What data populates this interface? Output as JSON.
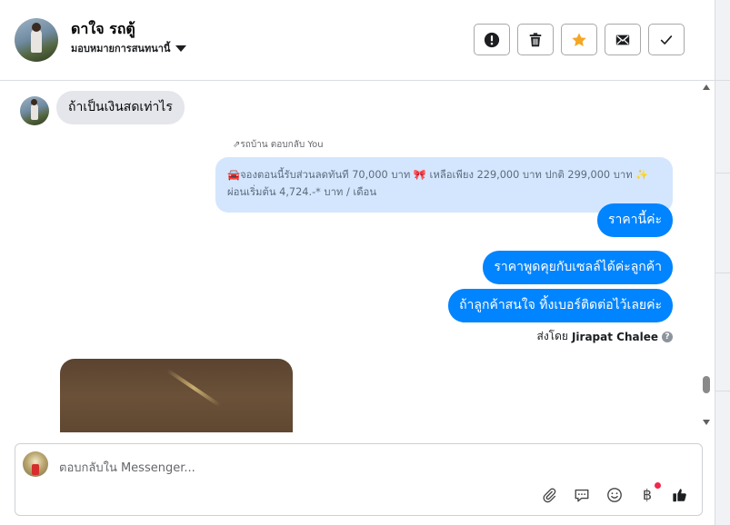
{
  "header": {
    "contact_name": "ดาใจ รถตู้",
    "assign_label": "มอบหมายการสนทนานี้",
    "buttons": [
      {
        "name": "spam-alert",
        "icon": "alert-circle-icon"
      },
      {
        "name": "delete",
        "icon": "trash-icon"
      },
      {
        "name": "star",
        "icon": "star-icon",
        "color": "#f5a623"
      },
      {
        "name": "mark-unread",
        "icon": "envelope-icon"
      },
      {
        "name": "mark-done",
        "icon": "checkmark-icon"
      }
    ]
  },
  "thread": {
    "incoming_message": "ถ้าเป็นเงินสดเท่าไร",
    "reply_meta": "รถบ้าน ตอบกลับ You",
    "quoted_message": "🚘จองตอนนี้รับส่วนลดทันที 70,000 บาท 🎀 เหลือเพียง 229,000 บาท ปกติ 299,000 บาท ✨ ผ่อนเริ่มต้น 4,724.-* บาท / เดือน",
    "outgoing_messages": [
      "ราคานี้ค่ะ",
      "ราคาพูดคุยกับเซลล์ได้ค่ะลูกค้า",
      "ถ้าลูกค้าสนใจ ทิ้งเบอร์ติดต่อไว้เลยค่ะ"
    ],
    "sent_by_prefix": "ส่งโดย",
    "sent_by_name": "Jirapat Chalee"
  },
  "composer": {
    "placeholder": "ตอบกลับใน Messenger...",
    "currency_symbol": "฿",
    "tools": [
      "paperclip-icon",
      "saved-replies-icon",
      "emoji-icon",
      "baht-icon",
      "like-icon"
    ]
  },
  "colors": {
    "outgoing_bubble": "#0084ff",
    "incoming_bubble": "#e4e6eb",
    "quote_bubble": "#d4e6fe",
    "star": "#f5a623"
  }
}
